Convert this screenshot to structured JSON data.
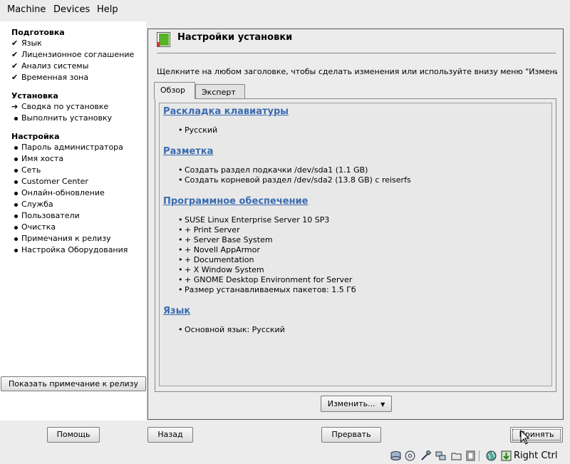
{
  "menubar": {
    "items": [
      "Machine",
      "Devices",
      "Help"
    ]
  },
  "steps": {
    "sections": [
      {
        "title": "Подготовка",
        "items": [
          {
            "label": "Язык",
            "state": "done"
          },
          {
            "label": "Лицензионное соглашение",
            "state": "done"
          },
          {
            "label": "Анализ системы",
            "state": "done"
          },
          {
            "label": "Временная зона",
            "state": "done"
          }
        ]
      },
      {
        "title": "Установка",
        "items": [
          {
            "label": "Сводка по установке",
            "state": "current"
          },
          {
            "label": "Выполнить установку",
            "state": "pending"
          }
        ]
      },
      {
        "title": "Настройка",
        "items": [
          {
            "label": "Пароль администратора",
            "state": "pending"
          },
          {
            "label": "Имя хоста",
            "state": "pending"
          },
          {
            "label": "Сеть",
            "state": "pending"
          },
          {
            "label": "Customer Center",
            "state": "pending"
          },
          {
            "label": "Онлайн-обновление",
            "state": "pending"
          },
          {
            "label": "Служба",
            "state": "pending"
          },
          {
            "label": "Пользователи",
            "state": "pending"
          },
          {
            "label": "Очистка",
            "state": "pending"
          },
          {
            "label": "Примечания к релизу",
            "state": "pending"
          },
          {
            "label": "Настройка Оборудования",
            "state": "pending"
          }
        ]
      }
    ],
    "release_notes_button": "Показать примечание к релизу"
  },
  "main": {
    "title": "Настройки установки",
    "instruction": "Щелкните на любом заголовке, чтобы сделать изменения или используйте внизу меню \"Изменить.",
    "tabs": [
      "Обзор",
      "Эксперт"
    ],
    "sections": [
      {
        "heading": "Раскладка клавиатуры",
        "items": [
          "Русский"
        ]
      },
      {
        "heading": "Разметка",
        "items": [
          "Создать раздел подкачки /dev/sda1 (1.1 GB)",
          "Создать корневой раздел /dev/sda2 (13.8 GB) с reiserfs"
        ]
      },
      {
        "heading": "Программное обеспечение",
        "items": [
          "SUSE Linux Enterprise Server 10 SP3",
          "+ Print Server",
          "+ Server Base System",
          "+ Novell AppArmor",
          "+ Documentation",
          "+ X Window System",
          "+ GNOME Desktop Environment for Server",
          "Размер устанавливаемых пакетов: 1.5 Гб"
        ]
      },
      {
        "heading": "Язык",
        "items": [
          "Основной язык: Русский"
        ]
      }
    ],
    "change_button": "Изменить..."
  },
  "footer": {
    "help": "Помощь",
    "back": "Назад",
    "abort": "Прервать",
    "accept": "Принять"
  },
  "statusbar": {
    "icons": [
      "hdd-icon",
      "cd-icon",
      "usb-icon",
      "network-icon",
      "shared-folder-icon",
      "display-icon",
      "video-capture-icon",
      "globe-icon",
      "mouse-integration-icon"
    ],
    "host_key": "Right Ctrl"
  },
  "colors": {
    "link": "#3a6bb0",
    "window_bg": "#ececec",
    "content_bg": "#e8e8e8"
  }
}
